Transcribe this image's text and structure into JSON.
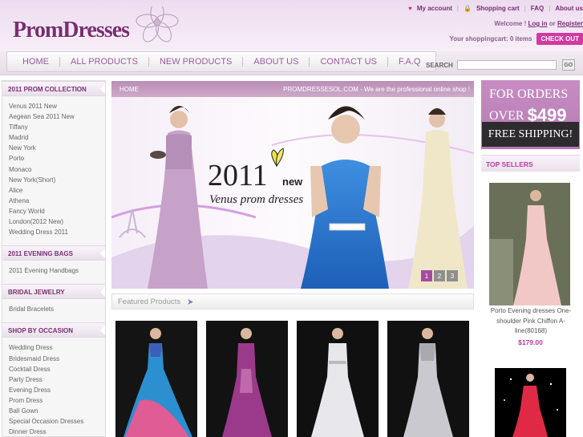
{
  "logo": {
    "text": "PromDresses"
  },
  "top_links": {
    "account": "My account",
    "cart": "Shopping cart",
    "faq": "FAQ",
    "about": "About us"
  },
  "welcome": {
    "prefix": "Welcome !",
    "login": "Log in",
    "or": "or",
    "register": "Register"
  },
  "cart": {
    "summary": "Your shoppingcart: 0 items",
    "checkout": "CHECK OUT"
  },
  "nav": {
    "items": [
      "HOME",
      "ALL PRODUCTS",
      "NEW PRODUCTS",
      "ABOUT US",
      "CONTACT US",
      "F.A.Q"
    ]
  },
  "search": {
    "label": "SEARCH",
    "placeholder": "",
    "button": "GO"
  },
  "sidebar": {
    "prom": {
      "title": "2011 PROM COLLECTION",
      "items": [
        "Venus 2011 New",
        "Aegean Sea 2011 New",
        "Tiffany",
        "Madrid",
        "New York",
        "Porto",
        "Monaco",
        "New York(Short)",
        "Alice",
        "Athena",
        "Fancy World",
        "London(2012 New)",
        "Wedding Dress 2011"
      ]
    },
    "bags": {
      "title": "2011 EVENING BAGS",
      "items": [
        "2011 Evening Handbags"
      ]
    },
    "jewelry": {
      "title": "BRIDAL JEWELRY",
      "items": [
        "Bridal Bracelets"
      ]
    },
    "occasion": {
      "title": "SHOP BY OCCASION",
      "items": [
        "Wedding Dress",
        "Bridesmaid Dress",
        "Cocktail Dress",
        "Party Dress",
        "Evening Dress",
        "Prom Dress",
        "Ball Gown",
        "Special Occasion Dresses",
        "Dinner Dress"
      ]
    }
  },
  "breadcrumb": {
    "home": "HOME",
    "tagline": "PROMDRESSESOL.COM - We are the professional online shop !"
  },
  "banner": {
    "year": "2011",
    "new": "new",
    "subtitle": "Venus prom dresses",
    "pages": [
      "1",
      "2",
      "3"
    ],
    "active_page": 1
  },
  "featured": {
    "title": "Featured Products"
  },
  "promo": {
    "line1": "FOR ORDERS",
    "line2": "OVER",
    "amount": "$499",
    "line3": "FREE SHIPPING!"
  },
  "top_sellers": {
    "title": "TOP SELLERS",
    "product_name": "Porto Evening dresses One-shoulder Pink Chiffon A-line(80168)",
    "price": "$179.00"
  },
  "colors": {
    "brand_purple": "#7a2d73",
    "accent_pink": "#c0399e",
    "checkout_bg": "#d13aa0"
  }
}
